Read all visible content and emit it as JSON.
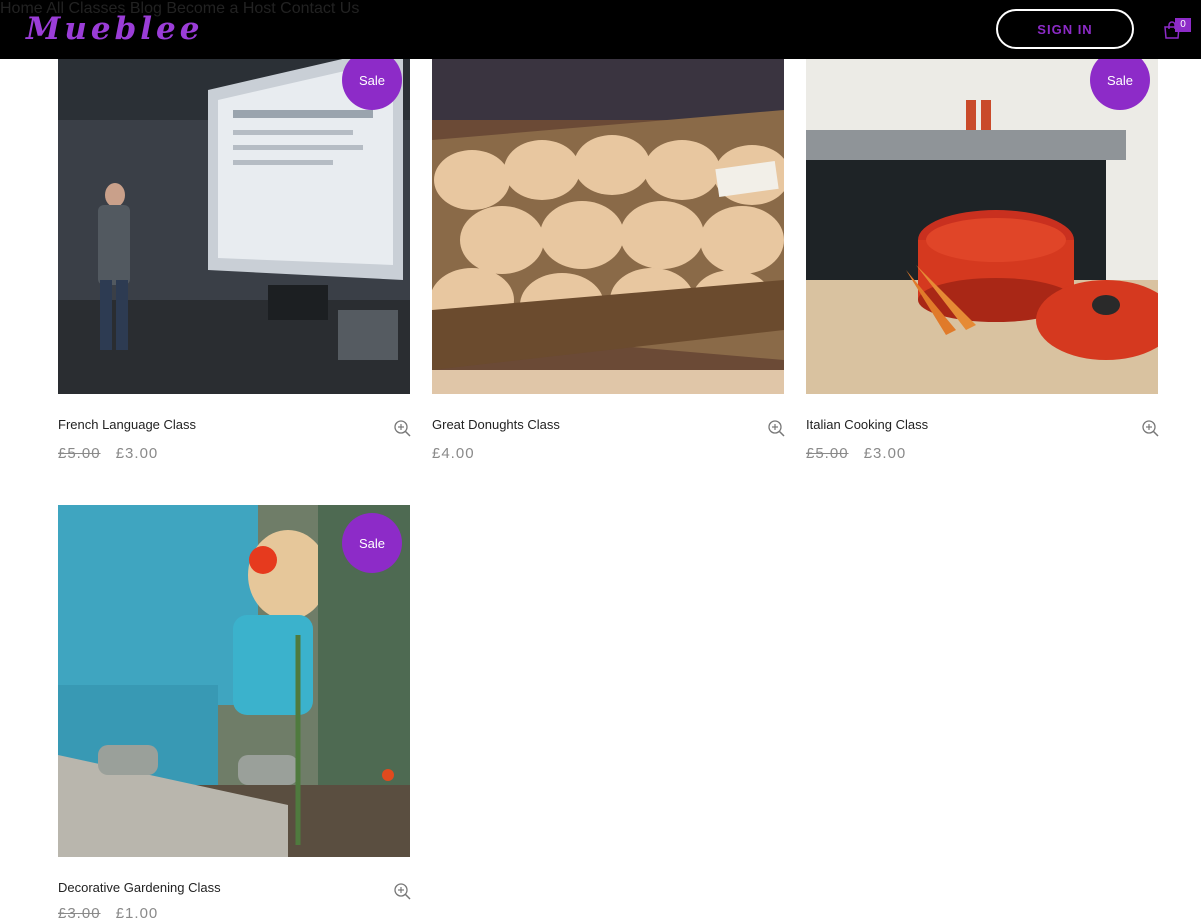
{
  "header": {
    "logo": "Mueblee",
    "nav": [
      {
        "label": "Home"
      },
      {
        "label": "All Classes"
      },
      {
        "label": "Blog"
      },
      {
        "label": "Become a Host"
      },
      {
        "label": "Contact Us"
      }
    ],
    "signin_label": "SIGN IN",
    "cart_count": "0"
  },
  "products": [
    {
      "title": "French Language Class",
      "sale_badge": "Sale",
      "old_price": "£5.00",
      "price": "£3.00"
    },
    {
      "title": "Great Donughts Class",
      "price": "£4.00"
    },
    {
      "title": "Italian Cooking Class",
      "sale_badge": "Sale",
      "old_price": "£5.00",
      "price": "£3.00"
    },
    {
      "title": "Decorative Gardening Class",
      "sale_badge": "Sale",
      "old_price": "£3.00",
      "price": "£1.00"
    }
  ],
  "colors": {
    "accent": "#8d2bc8",
    "header_bg": "#000000"
  },
  "icons": {
    "zoom": "zoom-in-icon",
    "cart": "shopping-bag-icon"
  }
}
